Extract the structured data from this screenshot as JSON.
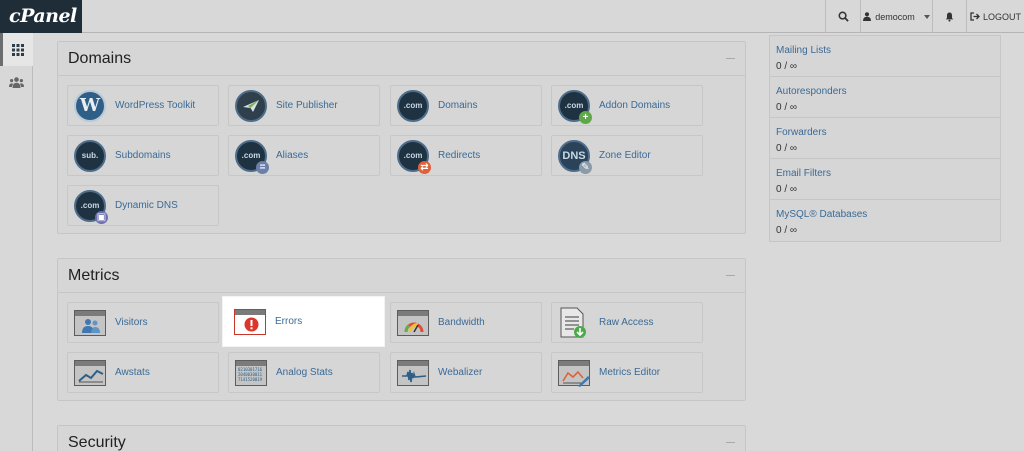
{
  "brand": {
    "logo": "cPanel"
  },
  "topbar": {
    "username": "democom",
    "logout": "LOGOUT"
  },
  "sections": {
    "domains": {
      "title": "Domains",
      "items": [
        {
          "label": "WordPress Toolkit",
          "icon": "wordpress-icon"
        },
        {
          "label": "Site Publisher",
          "icon": "site-publisher-icon"
        },
        {
          "label": "Domains",
          "icon": "domains-icon"
        },
        {
          "label": "Addon Domains",
          "icon": "addon-domains-icon"
        },
        {
          "label": "Subdomains",
          "icon": "subdomains-icon"
        },
        {
          "label": "Aliases",
          "icon": "aliases-icon"
        },
        {
          "label": "Redirects",
          "icon": "redirects-icon"
        },
        {
          "label": "Zone Editor",
          "icon": "zone-editor-icon"
        },
        {
          "label": "Dynamic DNS",
          "icon": "dynamic-dns-icon"
        }
      ]
    },
    "metrics": {
      "title": "Metrics",
      "items": [
        {
          "label": "Visitors",
          "icon": "visitors-icon"
        },
        {
          "label": "Errors",
          "icon": "errors-icon"
        },
        {
          "label": "Bandwidth",
          "icon": "bandwidth-icon"
        },
        {
          "label": "Raw Access",
          "icon": "raw-access-icon"
        },
        {
          "label": "Awstats",
          "icon": "awstats-icon"
        },
        {
          "label": "Analog Stats",
          "icon": "analog-stats-icon"
        },
        {
          "label": "Webalizer",
          "icon": "webalizer-icon"
        },
        {
          "label": "Metrics Editor",
          "icon": "metrics-editor-icon"
        }
      ]
    },
    "security": {
      "title": "Security"
    }
  },
  "icon_text": {
    "com": ".com",
    "sub": "sub.",
    "dns": "DNS",
    "wordpress": "W",
    "analog_lines": [
      "0210301716",
      "2040030011",
      "7141520019"
    ]
  },
  "stats": [
    {
      "name": "Mailing Lists",
      "value": "0 / ∞"
    },
    {
      "name": "Autoresponders",
      "value": "0 / ∞"
    },
    {
      "name": "Forwarders",
      "value": "0 / ∞"
    },
    {
      "name": "Email Filters",
      "value": "0 / ∞"
    },
    {
      "name": "MySQL® Databases",
      "value": "0 / ∞"
    }
  ],
  "colors": {
    "accent": "#3a6a96",
    "error_red": "#d9372b",
    "logo_bg": "#1f2d38"
  }
}
